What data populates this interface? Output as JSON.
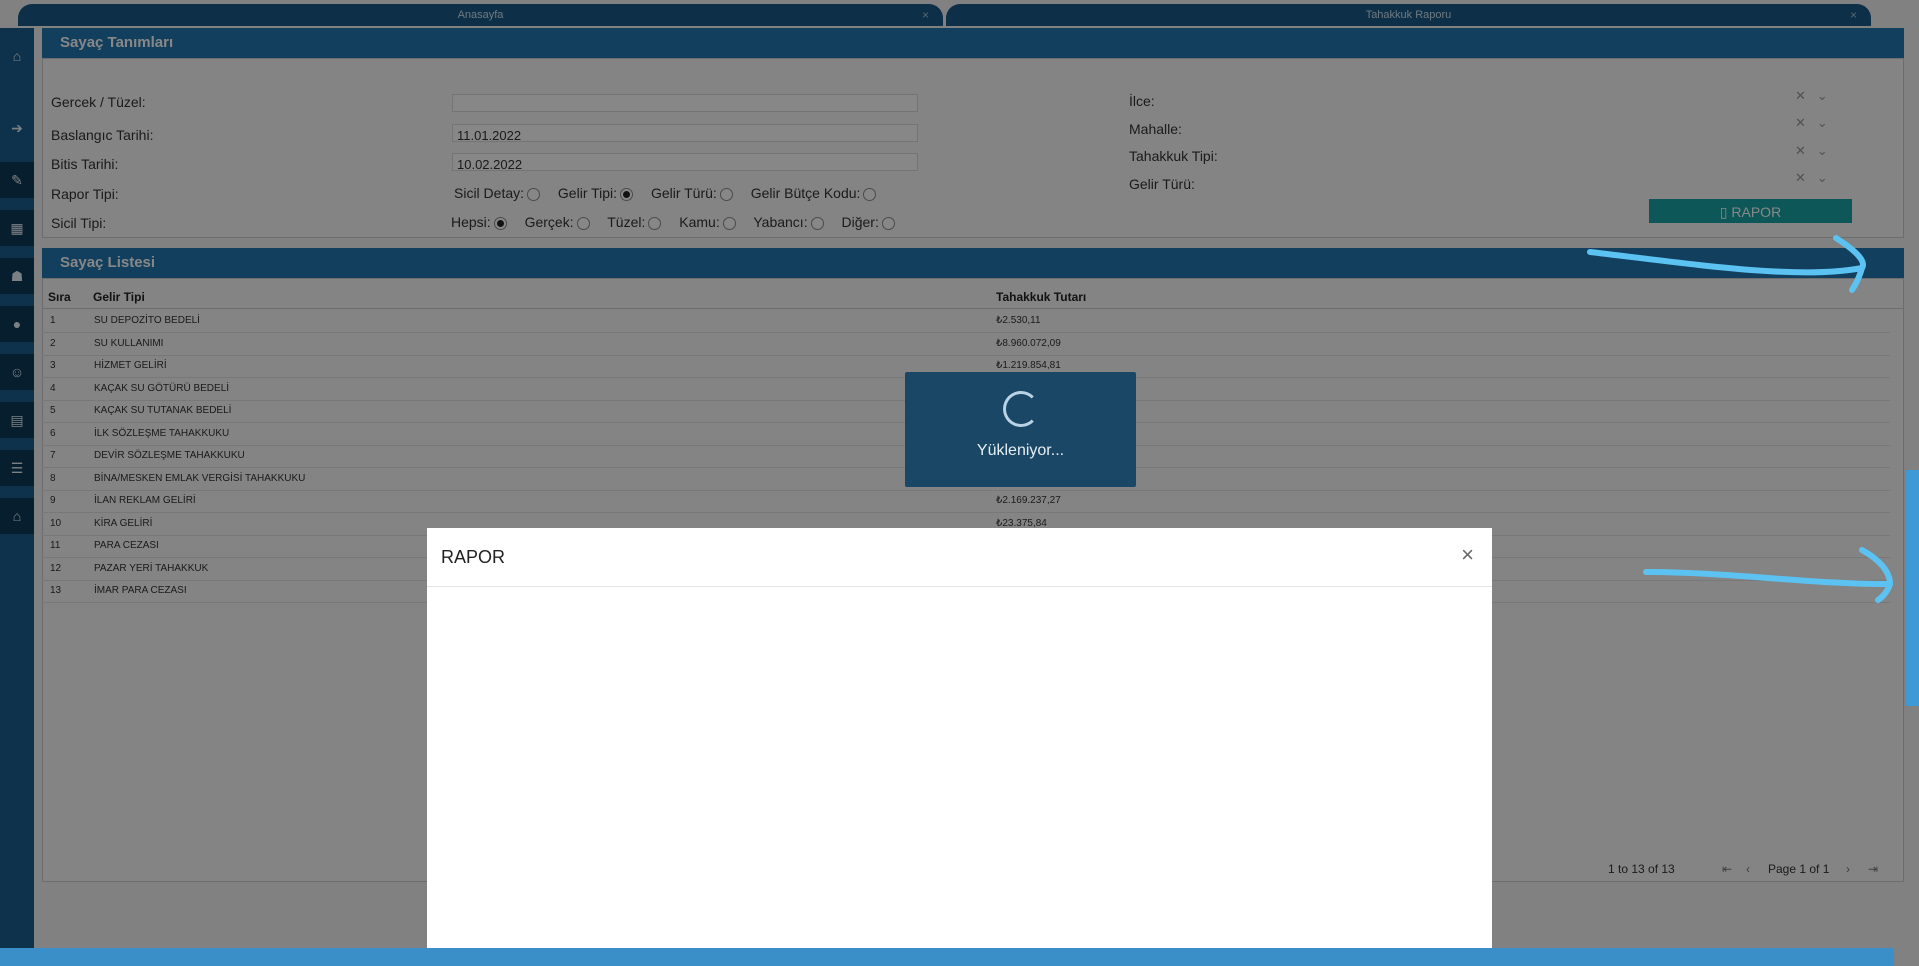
{
  "tabs": [
    {
      "label": "Anasayfa"
    },
    {
      "label": "Tahakkuk Raporu"
    }
  ],
  "sidebar": {
    "icons": [
      "home-icon",
      "logout-icon",
      "edit-icon",
      "dashboard-icon",
      "water-hand-icon",
      "drop-icon",
      "users-icon",
      "calculator-icon",
      "list-icon",
      "bank-icon"
    ]
  },
  "filter_panel": {
    "title": "Sayaç Tanımları",
    "gercek_tuzel_label": "Gercek / Tüzel:",
    "baslangic_label": "Baslangıc Tarihi:",
    "baslangic_value": "11.01.2022",
    "bitis_label": "Bitis Tarihi:",
    "bitis_value": "10.02.2022",
    "rapor_tipi_label": "Rapor Tipi:",
    "rapor_tipi_options": [
      "Sicil Detay:",
      "Gelir Tipi:",
      "Gelir Türü:",
      "Gelir Bütçe Kodu:"
    ],
    "rapor_tipi_selected": "Gelir Tipi:",
    "sicil_tipi_label": "Sicil Tipi:",
    "sicil_tipi_options": [
      "Hepsi:",
      "Gerçek:",
      "Tüzel:",
      "Kamu:",
      "Yabancı:",
      "Diğer:"
    ],
    "sicil_tipi_selected": "Hepsi:",
    "ilce_label": "İlce:",
    "mahalle_label": "Mahalle:",
    "tahakkuk_tipi_label": "Tahakkuk Tipi:",
    "gelir_turu_label": "Gelir Türü:",
    "rapor_button": "RAPOR"
  },
  "list_panel": {
    "title": "Sayaç Listesi",
    "columns": [
      "Sıra",
      "Gelir Tipi",
      "Tahakkuk Tutarı"
    ],
    "rows": [
      {
        "sira": "1",
        "gelir": "SU DEPOZİTO BEDELİ",
        "tutar": "₺2.530,11"
      },
      {
        "sira": "2",
        "gelir": "SU KULLANIMI",
        "tutar": "₺8.960.072,09"
      },
      {
        "sira": "3",
        "gelir": "HİZMET GELİRİ",
        "tutar": "₺1.219.854,81"
      },
      {
        "sira": "4",
        "gelir": "KAÇAK SU GÖTÜRÜ BEDELİ",
        "tutar": ""
      },
      {
        "sira": "5",
        "gelir": "KAÇAK SU TUTANAK BEDELİ",
        "tutar": ""
      },
      {
        "sira": "6",
        "gelir": "İLK SÖZLEŞME TAHAKKUKU",
        "tutar": ""
      },
      {
        "sira": "7",
        "gelir": "DEVİR SÖZLEŞME TAHAKKUKU",
        "tutar": ""
      },
      {
        "sira": "8",
        "gelir": "BİNA/MESKEN EMLAK VERGİSİ TAHAKKUKU",
        "tutar": ""
      },
      {
        "sira": "9",
        "gelir": "İLAN REKLAM GELİRİ",
        "tutar": "₺2.169.237,27"
      },
      {
        "sira": "10",
        "gelir": "KİRA GELİRİ",
        "tutar": "₺23.375,84"
      },
      {
        "sira": "11",
        "gelir": "PARA CEZASI",
        "tutar": ""
      },
      {
        "sira": "12",
        "gelir": "PAZAR YERİ TAHAKKUK",
        "tutar": ""
      },
      {
        "sira": "13",
        "gelir": "İMAR PARA CEZASI",
        "tutar": ""
      }
    ],
    "pager_range": "1 to 13 of 13",
    "pager_page": "Page 1 of 1"
  },
  "loading": {
    "text": "Yükleniyor..."
  },
  "modal": {
    "title": "RAPOR",
    "close": "×"
  },
  "colors": {
    "header": "#2377b0",
    "sidebar": "#1c5f8f",
    "button": "#1ba4a8",
    "annotation": "#5bc2f2"
  }
}
